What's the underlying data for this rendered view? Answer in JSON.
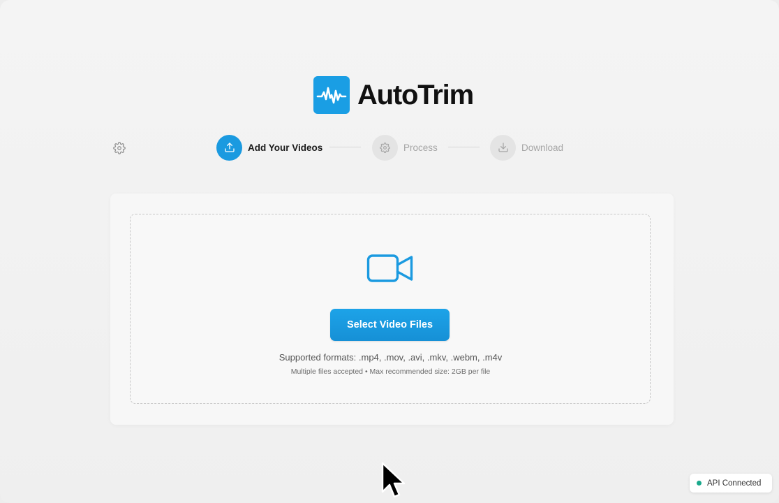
{
  "app": {
    "name": "AutoTrim",
    "logo_icon": "waveform-icon",
    "accent_color": "#1b9ae0"
  },
  "toolbar": {
    "settings_icon": "gear-icon"
  },
  "steps": [
    {
      "label": "Add Your Videos",
      "icon": "upload-icon",
      "state": "active"
    },
    {
      "label": "Process",
      "icon": "gear-icon",
      "state": "inactive"
    },
    {
      "label": "Download",
      "icon": "download-icon",
      "state": "inactive"
    }
  ],
  "upload": {
    "icon": "video-camera-icon",
    "button_label": "Select Video Files",
    "formats_text": "Supported formats: .mp4, .mov, .avi, .mkv, .webm, .m4v",
    "limits_text": "Multiple files accepted • Max recommended size: 2GB per file"
  },
  "status": {
    "text": "API Connected",
    "color": "#1aa98c"
  }
}
